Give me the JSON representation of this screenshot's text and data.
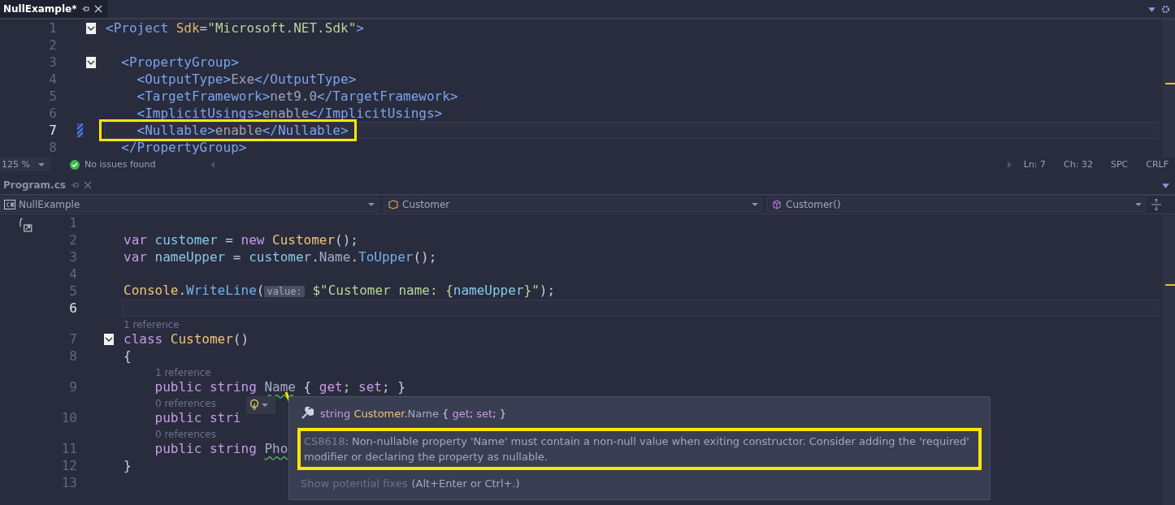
{
  "top_tabs": [
    {
      "label": "NullExample*",
      "selected": true
    }
  ],
  "project_editor": {
    "lines": [
      {
        "number": "1",
        "fold": true,
        "current": false,
        "changed": false,
        "tokens": [
          {
            "text": "<Project ",
            "kind": "tag"
          },
          {
            "text": "Sdk",
            "kind": "attr"
          },
          {
            "text": "=",
            "kind": "punct"
          },
          {
            "text": "\"Microsoft.NET.Sdk\"",
            "kind": "str"
          },
          {
            "text": ">",
            "kind": "tag"
          }
        ]
      },
      {
        "number": "2",
        "fold": false,
        "current": false,
        "changed": false
      },
      {
        "number": "3",
        "fold": true,
        "current": false,
        "changed": false,
        "tokens": [
          {
            "text": "  <PropertyGroup>",
            "kind": "tag"
          }
        ]
      },
      {
        "number": "4",
        "fold": false,
        "current": false,
        "changed": false,
        "tokens": [
          {
            "text": "    <OutputType>",
            "kind": "tag"
          },
          {
            "text": "Exe",
            "kind": "text"
          },
          {
            "text": "</OutputType>",
            "kind": "tag"
          }
        ]
      },
      {
        "number": "5",
        "fold": false,
        "current": false,
        "changed": false,
        "tokens": [
          {
            "text": "    <TargetFramework>",
            "kind": "tag"
          },
          {
            "text": "net9.0",
            "kind": "text"
          },
          {
            "text": "</TargetFramework>",
            "kind": "tag"
          }
        ]
      },
      {
        "number": "6",
        "fold": false,
        "current": false,
        "changed": false,
        "tokens": [
          {
            "text": "    <ImplicitUsings>",
            "kind": "tag"
          },
          {
            "text": "enable",
            "kind": "text"
          },
          {
            "text": "</ImplicitUsings>",
            "kind": "tag"
          }
        ]
      },
      {
        "number": "7",
        "fold": false,
        "current": true,
        "changed": true,
        "highlighted": true,
        "tokens": [
          {
            "text": "    <Nullable>",
            "kind": "tag"
          },
          {
            "text": "enable",
            "kind": "text"
          },
          {
            "text": "</Nullable>",
            "kind": "tag"
          }
        ]
      },
      {
        "number": "8",
        "fold": false,
        "current": false,
        "changed": false,
        "tokens": [
          {
            "text": "  </PropertyGroup>",
            "kind": "tag"
          }
        ]
      }
    ]
  },
  "project_status": {
    "zoom": "125 %",
    "issues": "No issues found",
    "position": [
      "Ln: 7",
      "Ch: 32",
      "SPC",
      "CRLF"
    ]
  },
  "bottom_tabs": [
    {
      "label": "Program.cs",
      "selected": false
    }
  ],
  "nav_bar": [
    {
      "label": "NullExample",
      "kind": "project"
    },
    {
      "label": "Customer",
      "kind": "class"
    },
    {
      "label": "Customer()",
      "kind": "method"
    }
  ],
  "program_editor": {
    "lines": [
      {
        "number": "1",
        "fold": false,
        "current": false
      },
      {
        "number": "2",
        "fold": false,
        "current": false,
        "tokens": [
          {
            "text": "var ",
            "kind": "kw"
          },
          {
            "text": "customer",
            "kind": "ident"
          },
          {
            "text": " = ",
            "kind": "punct"
          },
          {
            "text": "new ",
            "kind": "kw"
          },
          {
            "text": "Customer",
            "kind": "type"
          },
          {
            "text": "();",
            "kind": "punct"
          }
        ]
      },
      {
        "number": "3",
        "fold": false,
        "current": false,
        "tokens": [
          {
            "text": "var ",
            "kind": "kw"
          },
          {
            "text": "nameUpper",
            "kind": "ident"
          },
          {
            "text": " = ",
            "kind": "punct"
          },
          {
            "text": "customer",
            "kind": "ident"
          },
          {
            "text": ".",
            "kind": "punct"
          },
          {
            "text": "Name",
            "kind": "member"
          },
          {
            "text": ".",
            "kind": "punct"
          },
          {
            "text": "ToUpper",
            "kind": "method"
          },
          {
            "text": "();",
            "kind": "punct"
          }
        ]
      },
      {
        "number": "4",
        "fold": false,
        "current": false
      },
      {
        "number": "5",
        "fold": false,
        "current": false,
        "tokens": [
          {
            "text": "Console",
            "kind": "type"
          },
          {
            "text": ".",
            "kind": "punct"
          },
          {
            "text": "WriteLine",
            "kind": "method"
          },
          {
            "text": "(",
            "kind": "punct"
          },
          {
            "text": "value:",
            "kind": "hint"
          },
          {
            "text": " $\"Customer name: {",
            "kind": "str"
          },
          {
            "text": "nameUpper",
            "kind": "ident"
          },
          {
            "text": "}\"",
            "kind": "str"
          },
          {
            "text": ");",
            "kind": "punct"
          }
        ]
      },
      {
        "number": "6",
        "fold": false,
        "current": true
      },
      {
        "number": "7",
        "fold": true,
        "current": false,
        "codelens": "1 reference",
        "tokens": [
          {
            "text": "class ",
            "kind": "kw"
          },
          {
            "text": "Customer",
            "kind": "type"
          },
          {
            "text": "()",
            "kind": "punct"
          }
        ]
      },
      {
        "number": "8",
        "fold": false,
        "current": false,
        "tokens": [
          {
            "text": "{",
            "kind": "punct"
          }
        ]
      },
      {
        "number": "9",
        "fold": false,
        "current": false,
        "codelens": "1 reference",
        "tokens": [
          {
            "text": "    public string ",
            "kind": "kw"
          },
          {
            "text": "Name",
            "kind": "member",
            "squiggle": true
          },
          {
            "text": " { ",
            "kind": "punct"
          },
          {
            "text": "get",
            "kind": "kw"
          },
          {
            "text": "; ",
            "kind": "punct"
          },
          {
            "text": "set",
            "kind": "kw"
          },
          {
            "text": "; }",
            "kind": "punct"
          }
        ]
      },
      {
        "number": "10",
        "fold": false,
        "current": false,
        "codelens": "0 references",
        "tokens": [
          {
            "text": "    public stri",
            "kind": "kw"
          }
        ]
      },
      {
        "number": "11",
        "fold": false,
        "current": false,
        "codelens": "0 references",
        "tokens": [
          {
            "text": "    public string ",
            "kind": "kw"
          },
          {
            "text": "Pho",
            "kind": "member",
            "squiggle": true
          }
        ]
      },
      {
        "number": "12",
        "fold": false,
        "current": false,
        "tokens": [
          {
            "text": "}",
            "kind": "punct"
          }
        ]
      },
      {
        "number": "13",
        "fold": false,
        "current": false
      }
    ]
  },
  "quick_info": {
    "signature": [
      {
        "text": "string ",
        "kind": "kw"
      },
      {
        "text": "Customer",
        "kind": "type"
      },
      {
        "text": ".",
        "kind": "punct"
      },
      {
        "text": "Name",
        "kind": "member"
      },
      {
        "text": " { ",
        "kind": "punct"
      },
      {
        "text": "get",
        "kind": "kw"
      },
      {
        "text": "; ",
        "kind": "punct"
      },
      {
        "text": "set",
        "kind": "kw"
      },
      {
        "text": "; }",
        "kind": "punct"
      }
    ],
    "code": "CS8618",
    "message": ": Non-nullable property 'Name' must contain a non-null value when exiting constructor. Consider adding the 'required' modifier or declaring the property as nullable.",
    "fixes_link": "Show potential fixes",
    "fixes_shortcut": "(Alt+Enter or Ctrl+.)",
    "highlighted": true
  }
}
